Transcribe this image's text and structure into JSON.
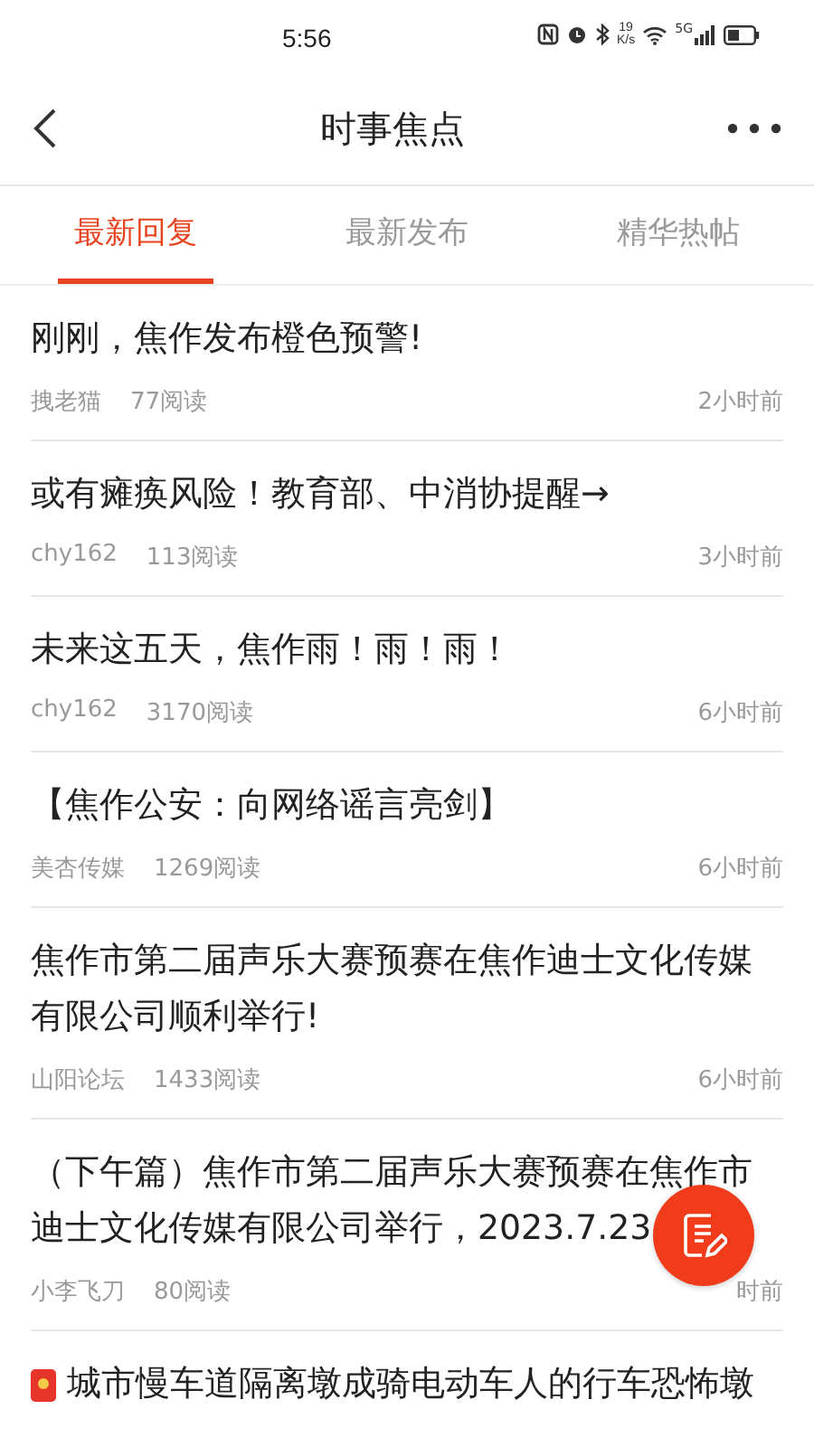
{
  "status_bar": {
    "time": "5:56",
    "speed": "19",
    "speed_unit": "K/s",
    "network": "5G"
  },
  "header": {
    "title": "时事焦点"
  },
  "tabs": [
    {
      "label": "最新回复",
      "selected": true
    },
    {
      "label": "最新发布",
      "selected": false
    },
    {
      "label": "精华热帖",
      "selected": false
    }
  ],
  "posts": [
    {
      "kind": "plain",
      "title": "刚刚，焦作发布橙色预警!",
      "author": "拽老猫",
      "reads": "77阅读",
      "time": "2小时前"
    },
    {
      "kind": "plain",
      "title": "或有瘫痪风险！教育部、中消协提醒→",
      "author": "chy162",
      "reads": "113阅读",
      "time": "3小时前"
    },
    {
      "kind": "plain",
      "title": "未来这五天，焦作雨！雨！雨！",
      "author": "chy162",
      "reads": "3170阅读",
      "time": "6小时前"
    },
    {
      "kind": "plain",
      "title": "【焦作公安：向网络谣言亮剑】",
      "author": "美杏传媒",
      "reads": "1269阅读",
      "time": "6小时前"
    },
    {
      "kind": "plain",
      "title": "焦作市第二届声乐大赛预赛在焦作迪士文化传媒有限公司顺利举行!",
      "author": "山阳论坛",
      "reads": "1433阅读",
      "time": "6小时前"
    },
    {
      "kind": "plain",
      "title": "（下午篇）焦作市第二届声乐大赛预赛在焦作市迪士文化传媒有限公司举行，2023.7.23",
      "author": "小李飞刀",
      "reads": "80阅读",
      "time": "时前"
    },
    {
      "kind": "redpacket",
      "title": "城市慢车道隔离墩成骑电动车人的行车恐怖墩"
    }
  ]
}
